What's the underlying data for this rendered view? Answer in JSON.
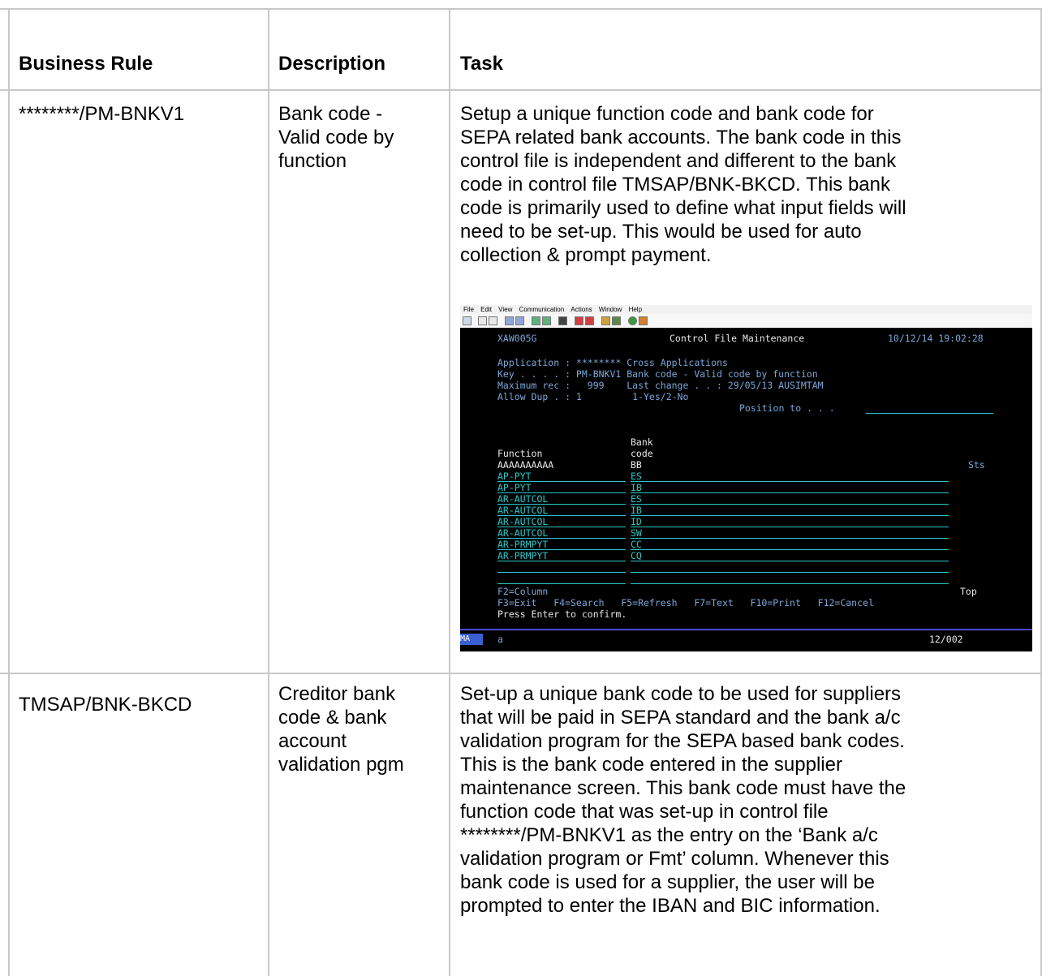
{
  "table": {
    "headers": [
      "Business Rule",
      "Description",
      "Task"
    ],
    "rows": [
      {
        "rule": "********/PM-BNKV1",
        "description": "Bank code -\nValid code by\nfunction",
        "task": "Setup a unique function code and bank code for\nSEPA related bank accounts. The bank code in this\ncontrol file is independent and different to the bank\ncode in control file TMSAP/BNK-BKCD. This bank\ncode is primarily used to define what input fields will\nneed to be set-up. This would be used for auto\ncollection & prompt payment."
      },
      {
        "rule": "TMSAP/BNK-BKCD",
        "description": "Creditor bank\ncode & bank\naccount\nvalidation pgm",
        "task": "Set-up a unique bank code to be used for suppliers\nthat will be paid in SEPA standard and the bank a/c\nvalidation program for the SEPA based bank codes.\nThis is the bank code entered in the supplier\nmaintenance screen. This bank code must have the\nfunction code that was set-up in control file\n********/PM-BNKV1 as the entry on the ‘Bank a/c\nvalidation program or Fmt’ column. Whenever this\nbank code is used for a supplier, the user will be\nprompted to enter the IBAN and BIC information."
      }
    ]
  },
  "screenshot": {
    "menu": [
      "File",
      "Edit",
      "View",
      "Communication",
      "Actions",
      "Window",
      "Help"
    ],
    "program_id": "XAW005G",
    "screen_title": "Control File Maintenance",
    "datetime": "10/12/14 19:02:28",
    "application_line": "Application : ******** Cross Applications",
    "key_line": "Key . . . . : PM-BNKV1 Bank code - Valid code by function",
    "max_rec_line": "Maximum rec :   999    Last change . . : 29/05/13 AUSIMTAM",
    "allow_dup_line": "Allow Dup . : 1         1-Yes/2-No",
    "position_to": "Position to . . .",
    "col_bank": "Bank",
    "col_function": "Function",
    "col_code": "code",
    "mask_function": "AAAAAAAAAA",
    "mask_code": "BB",
    "col_sts": "Sts",
    "rows": [
      {
        "function": "AP-PYT",
        "code": "ES"
      },
      {
        "function": "AP-PYT",
        "code": "IB"
      },
      {
        "function": "AR-AUTCOL",
        "code": "ES"
      },
      {
        "function": "AR-AUTCOL",
        "code": "IB"
      },
      {
        "function": "AR-AUTCOL",
        "code": "ID"
      },
      {
        "function": "AR-AUTCOL",
        "code": "SW"
      },
      {
        "function": "AR-PRMPYT",
        "code": "CC"
      },
      {
        "function": "AR-PRMPYT",
        "code": "CQ"
      }
    ],
    "f2": "F2=Column",
    "top": "Top",
    "fkeys": "F3=Exit   F4=Search   F5=Refresh   F7=Text   F10=Print   F12=Cancel",
    "prompt": "Press Enter to confirm.",
    "status_mode": "MA",
    "status_a": "a",
    "status_pos": "12/002"
  }
}
